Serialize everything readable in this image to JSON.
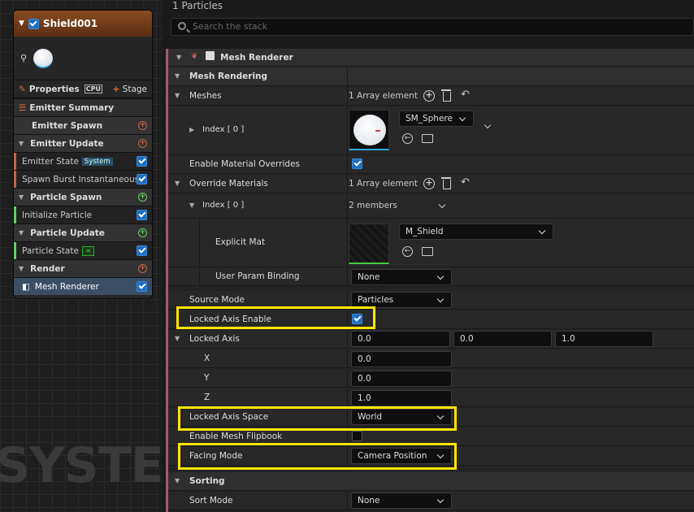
{
  "left": {
    "emitter_name": "Shield001",
    "properties_label": "Properties",
    "cpu_label": "CPU",
    "stage_label": "Stage",
    "sections": [
      {
        "label": "Emitter Summary"
      },
      {
        "label": "Emitter Spawn"
      },
      {
        "label": "Emitter Update"
      },
      {
        "label": "Particle Spawn"
      },
      {
        "label": "Particle Update"
      },
      {
        "label": "Render"
      }
    ],
    "items": {
      "emitter_state": "Emitter State",
      "emitter_state_badge": "System",
      "spawn_burst": "Spawn Burst Instantaneous",
      "init_particle": "Initialize Particle",
      "particle_state": "Particle State",
      "particle_state_badge": "∞",
      "mesh_renderer": "Mesh Renderer"
    },
    "watermark": "SYSTEM"
  },
  "right": {
    "count": "1 Particles",
    "search_placeholder": "Search the stack",
    "title": "Mesh Renderer",
    "mesh_rendering": "Mesh Rendering",
    "meshes": "Meshes",
    "array_1": "1 Array element",
    "index0": "Index [ 0 ]",
    "sm_sphere": "SM_Sphere",
    "enable_mat_overrides": "Enable Material Overrides",
    "override_materials": "Override Materials",
    "array_2": "1 Array element",
    "index0b": "Index [ 0 ]",
    "two_members": "2 members",
    "explicit_mat": "Explicit Mat",
    "m_shield": "M_Shield",
    "user_param": "User Param Binding",
    "none1": "None",
    "source_mode": "Source Mode",
    "particles": "Particles",
    "locked_axis_enable": "Locked Axis Enable",
    "locked_axis": "Locked Axis",
    "lx": "0.0",
    "ly": "0.0",
    "lz": "1.0",
    "x_label": "X",
    "y_label": "Y",
    "z_label": "Z",
    "xv": "0.0",
    "yv": "0.0",
    "zv": "1.0",
    "locked_axis_space": "Locked Axis Space",
    "world": "World",
    "enable_flipbook": "Enable Mesh Flipbook",
    "facing_mode": "Facing Mode",
    "camera_position": "Camera Position",
    "sorting": "Sorting",
    "sort_mode": "Sort Mode",
    "none2": "None"
  },
  "colors": {
    "highlight": "#ffe600",
    "accent": "#1d6fbf",
    "emitter_header": "#8a4a22"
  }
}
